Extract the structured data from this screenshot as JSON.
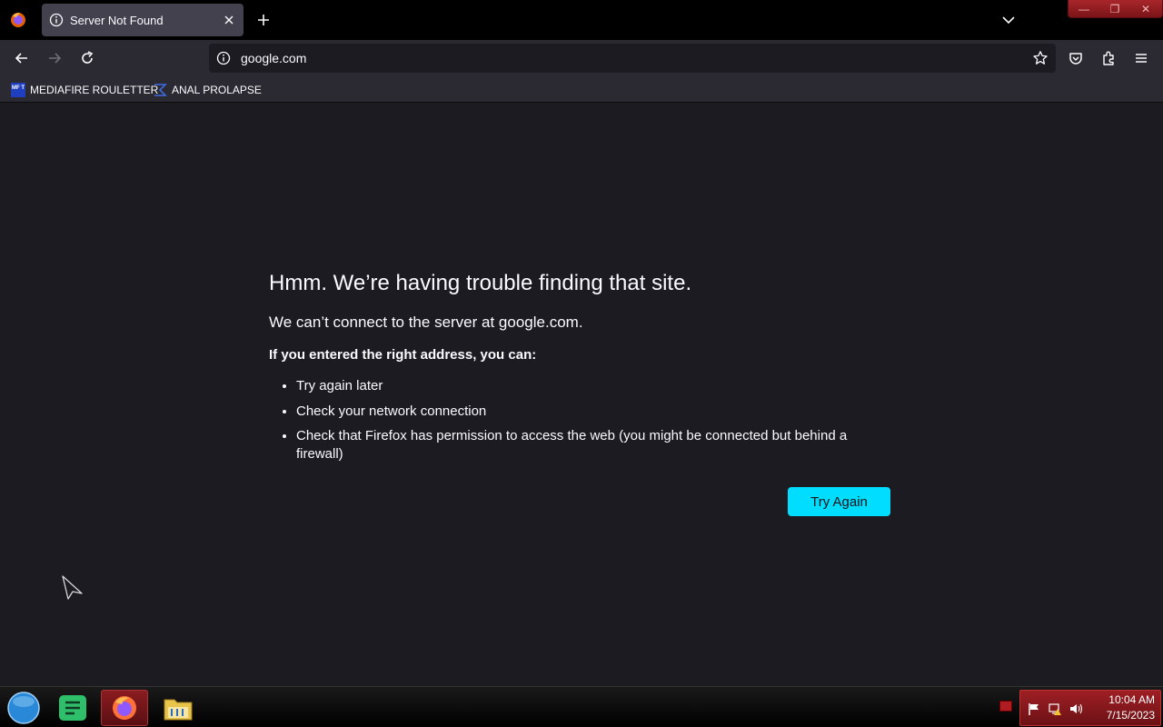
{
  "tab": {
    "title": "Server Not Found"
  },
  "url": {
    "value": "google.com"
  },
  "bookmarks": [
    {
      "label": "MEDIAFIRE ROULETTER",
      "icon": "mediafire-icon",
      "icon_text": "MF T"
    },
    {
      "label": "ANAL PROLAPSE",
      "icon": "sigma-icon"
    }
  ],
  "error": {
    "title": "Hmm. We’re having trouble finding that site.",
    "description": "We can’t connect to the server at google.com.",
    "hint": "If you entered the right address, you can:",
    "items": [
      "Try again later",
      "Check your network connection",
      "Check that Firefox has permission to access the web (you might be connected but behind a firewall)"
    ],
    "button": "Try Again"
  },
  "clock": {
    "time": "10:04 AM",
    "date": "7/15/2023"
  },
  "colors": {
    "accent": "#00ddff",
    "page_bg": "#1c1b22",
    "toolbar_bg": "#2b2a33",
    "tab_bg": "#42414d",
    "taskbar_active": "#8a1c20"
  }
}
